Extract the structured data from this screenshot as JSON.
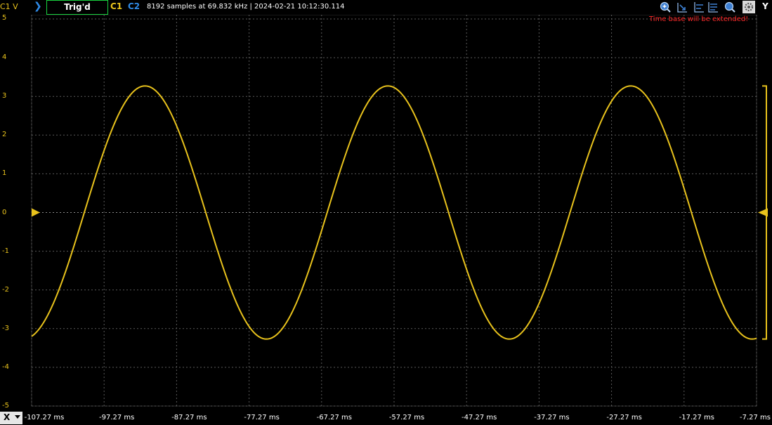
{
  "header": {
    "channel_label": "C1 V",
    "trigger_status": "Trig'd",
    "channel1": "C1",
    "channel2": "C2",
    "acquisition_info": "8192 samples at 69.832 kHz | 2024-02-21 10:12:30.114",
    "y_button": "Y",
    "timebase_note": "Time base will be extended!"
  },
  "footer": {
    "x_selector": "X"
  },
  "colors": {
    "trace": "#e8c21c",
    "grid": "#5a5a5a",
    "trigger_box": "#19d23f",
    "note": "#ff2a2a",
    "accent_blue": "#2f8be8"
  },
  "toolbar_icons": [
    "zoom-in-icon",
    "cursor-icon",
    "marker-icon",
    "measure-icon",
    "zoom-icon",
    "settings-icon"
  ],
  "chart_data": {
    "type": "line",
    "series": [
      {
        "channel": "C1",
        "waveform": "sine",
        "amplitude": 3.27,
        "period_ms": 33.5,
        "phase_ref_x": -107.27,
        "phase_ref_value": -3.2
      }
    ],
    "xlim": [
      -107.27,
      -7.27
    ],
    "ylim": [
      -5,
      5
    ],
    "x_ticks": [
      "-107.27 ms",
      "-97.27 ms",
      "-87.27 ms",
      "-77.27 ms",
      "-67.27 ms",
      "-57.27 ms",
      "-47.27 ms",
      "-37.27 ms",
      "-27.27 ms",
      "-17.27 ms",
      "-7.27 ms"
    ],
    "y_ticks": [
      "5",
      "4",
      "3",
      "2",
      "1",
      "0",
      "-1",
      "-2",
      "-3",
      "-4",
      "-5"
    ],
    "trigger_level": 0,
    "grid": true
  }
}
